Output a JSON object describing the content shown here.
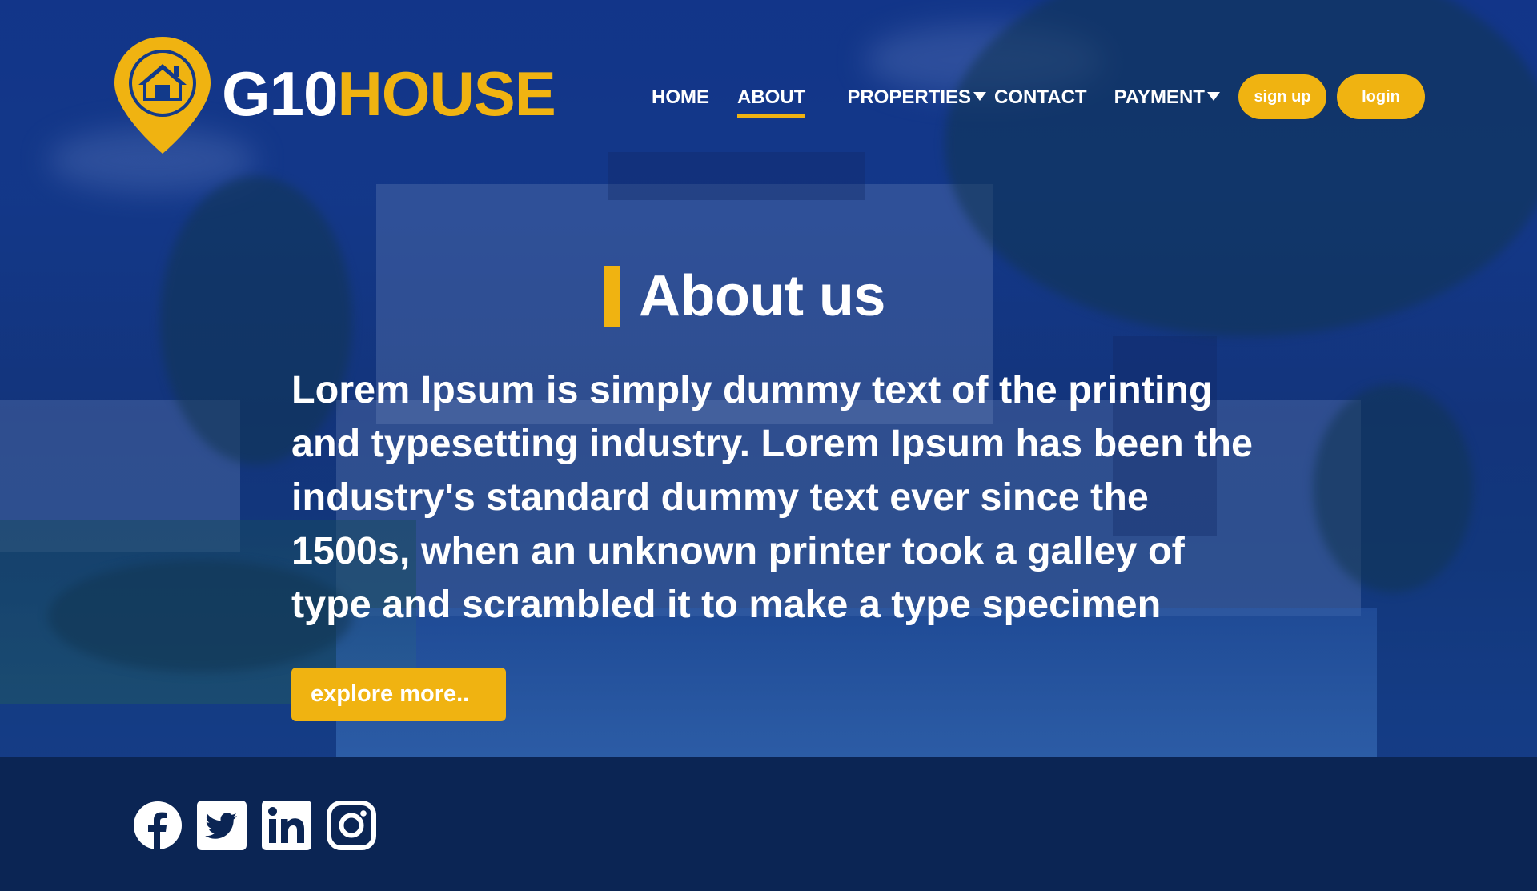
{
  "brand": {
    "name_part1": "G10",
    "name_part2": "HOUSE",
    "accent_color": "#f0b311",
    "logo_icon": "map-pin-house-icon"
  },
  "nav": {
    "items": [
      {
        "label": "HOME"
      },
      {
        "label": "ABOUT",
        "active": true
      },
      {
        "label": "PROPERTIES",
        "has_dropdown": true
      },
      {
        "label": "CONTACT"
      },
      {
        "label": "PAYMENT",
        "has_dropdown": true
      }
    ],
    "signup_label": "sign up",
    "login_label": "login"
  },
  "about": {
    "title": "About us",
    "body": "Lorem Ipsum is simply dummy text of the printing and typesetting industry. Lorem Ipsum has been the industry's standard dummy text ever since the 1500s, when an unknown printer took a galley of type and scrambled it to make a type specimen",
    "cta_label": "explore more.."
  },
  "footer": {
    "background_color": "#0b2554",
    "social_icons": [
      "facebook-icon",
      "twitter-icon",
      "linkedin-icon",
      "instagram-icon"
    ]
  }
}
